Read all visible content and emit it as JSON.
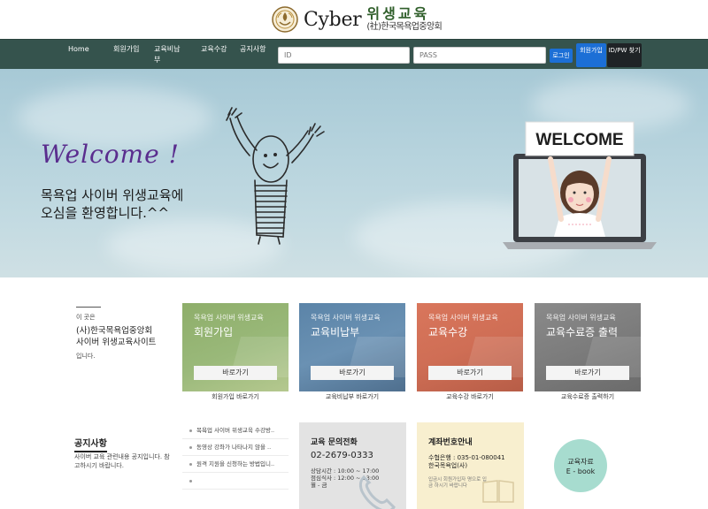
{
  "header": {
    "logo_word": "Cyber",
    "logo_main": "위생교육",
    "logo_sub": "(社)한국목욕업중앙회"
  },
  "nav": {
    "items": [
      {
        "label": "Home"
      },
      {
        "label": "회원가입"
      },
      {
        "label": "교육비납부"
      },
      {
        "label": "교육수강"
      },
      {
        "label": "공지사항"
      }
    ],
    "id_placeholder": "ID",
    "pass_placeholder": "PASS",
    "login_label": "로그인",
    "join_label": "회원가입",
    "find_label": "ID/PW 찾기"
  },
  "hero": {
    "welcome": "Welcome !",
    "line1": "목욕업 사이버 위생교육에",
    "line2": "오심을 환영합니다.^^",
    "sign_text": "WELCOME"
  },
  "intro": {
    "small": "이 곳은",
    "title1": "(사)한국목욕업중앙회",
    "title2": "사이버 위생교육사이트",
    "end": "입니다."
  },
  "cards": [
    {
      "sub": "목욕업 사이버 위생교육",
      "title": "회원가입",
      "button": "바로가기",
      "caption": "회원가입 바로가기"
    },
    {
      "sub": "목욕업 사이버 위생교육",
      "title": "교육비납부",
      "button": "바로가기",
      "caption": "교육비납부 바로가기"
    },
    {
      "sub": "목욕업 사이버 위생교육",
      "title": "교육수강",
      "button": "바로가기",
      "caption": "교육수강 바로가기"
    },
    {
      "sub": "목욕업 사이버 위생교육",
      "title": "교육수료증 출력",
      "button": "바로가기",
      "caption": "교육수료증 출력하기"
    }
  ],
  "notice": {
    "heading": "공지사항",
    "desc": "사이버 교육 관련내용 공지입니다. 참고하시기 바랍니다.",
    "items": [
      "목욕업 사이버 위생교육 수강방..",
      "동영상 강좌가 나타나지 않을 ..",
      "원격 지원을 신청하는 방법입니..",
      ""
    ]
  },
  "phone": {
    "heading": "교육 문의전화",
    "number": "02-2679-0333",
    "hours1": "상담시간 :  10:00 ~ 17:00",
    "hours2": "점심식사 :  12:00 ~ 13:00",
    "hours3": "월 - 금"
  },
  "bank": {
    "heading": "계좌번호안내",
    "line1": "수협은행 : 035-01-080041",
    "line2": "한국목욕업(사)",
    "note": "입금시 회원가입자 명으로 입금 하시기 바랍니다"
  },
  "ebook": {
    "line1": "교육자료",
    "line2": "E - book"
  },
  "colors": {
    "nav_bg": "#35534d",
    "accent_blue": "#1c6fd6",
    "card_green": "#8eae6a",
    "card_blue": "#5b84a8",
    "card_orange": "#d9765c",
    "card_gray": "#8a8a8a",
    "ebook_teal": "#a7dccf"
  }
}
